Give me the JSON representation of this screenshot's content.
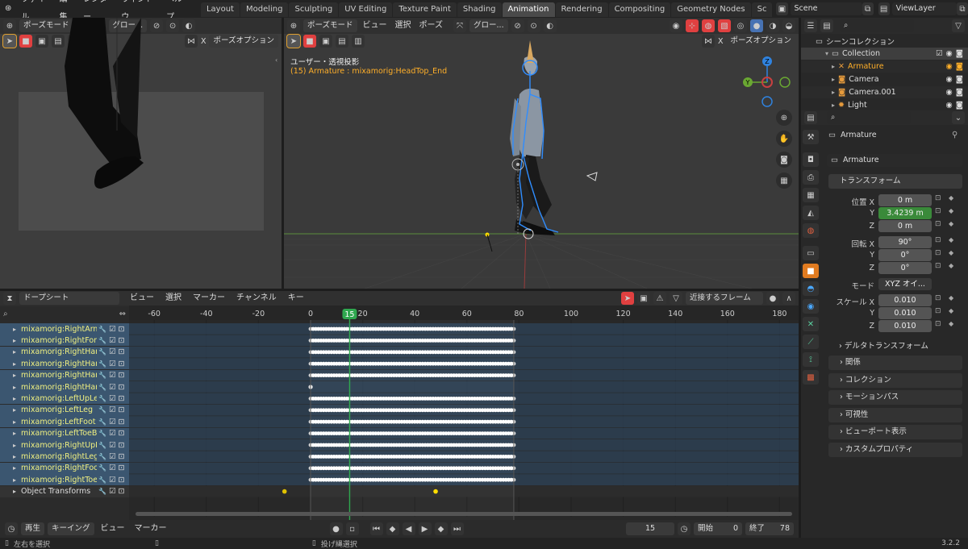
{
  "topbar": {
    "menus": [
      "ファイル",
      "編集",
      "レンダー",
      "ウィンドウ",
      "ヘルプ"
    ],
    "workspaces": [
      "Layout",
      "Modeling",
      "Sculpting",
      "UV Editing",
      "Texture Paint",
      "Shading",
      "Animation",
      "Rendering",
      "Compositing",
      "Geometry Nodes",
      "Sc"
    ],
    "active_workspace": "Animation",
    "scene": "Scene",
    "view_layer": "ViewLayer"
  },
  "left_viewport": {
    "mode": "ポーズモード",
    "transform": "グロー...",
    "x_label": "X",
    "options": "ポーズオプション"
  },
  "main_viewport": {
    "mode": "ポーズモード",
    "menus": [
      "ビュー",
      "選択",
      "ポーズ"
    ],
    "transform": "グロー...",
    "x_label": "X",
    "options": "ポーズオプション",
    "projection": "ユーザー・透視投影",
    "active": "(15) Armature : mixamorig:HeadTop_End",
    "gizmo": {
      "x": "X",
      "y": "Y",
      "z": "Z"
    }
  },
  "outliner": {
    "root": "シーンコレクション",
    "items": [
      {
        "label": "Collection",
        "highlight": false
      },
      {
        "label": "Armature",
        "highlight": true
      },
      {
        "label": "Camera",
        "highlight": false
      },
      {
        "label": "Camera.001",
        "highlight": false
      },
      {
        "label": "Light",
        "highlight": false
      }
    ]
  },
  "properties": {
    "object_name": "Armature",
    "data_name": "Armature",
    "transform_title": "トランスフォーム",
    "location_label": "位置 X",
    "y_label": "Y",
    "z_label": "Z",
    "loc_x": "0 m",
    "loc_y": "3.4239 m",
    "loc_z": "0 m",
    "rotation_label": "回転 X",
    "rot_x": "90°",
    "rot_y": "0°",
    "rot_z": "0°",
    "mode_label": "モード",
    "mode_value": "XYZ オイ...",
    "scale_label": "スケール X",
    "scale_x": "0.010",
    "scale_y": "0.010",
    "scale_z": "0.010",
    "delta": "デルタトランスフォーム",
    "panels": [
      "関係",
      "コレクション",
      "モーションパス",
      "可視性",
      "ビューポート表示",
      "カスタムプロパティ"
    ]
  },
  "dopesheet": {
    "mode": "ドープシート",
    "menus": [
      "ビュー",
      "選択",
      "マーカー",
      "チャンネル",
      "キー"
    ],
    "snap": "近接するフレーム",
    "ruler": [
      "-60",
      "-40",
      "-20",
      "0",
      "20",
      "40",
      "60",
      "80",
      "100",
      "120",
      "140",
      "160",
      "180"
    ],
    "current_frame": "15",
    "channels": [
      {
        "label": "mixamorig:RightArm",
        "dense": true
      },
      {
        "label": "mixamorig:RightForeA",
        "dense": true
      },
      {
        "label": "mixamorig:RightHand",
        "dense": true
      },
      {
        "label": "mixamorig:RightHand",
        "dense": true
      },
      {
        "label": "mixamorig:RightHand",
        "dense": true
      },
      {
        "label": "mixamorig:RightHand",
        "dense": false
      },
      {
        "label": "mixamorig:LeftUpLeg",
        "dense": true
      },
      {
        "label": "mixamorig:LeftLeg",
        "dense": true
      },
      {
        "label": "mixamorig:LeftFoot",
        "dense": true
      },
      {
        "label": "mixamorig:LeftToeBa",
        "dense": true
      },
      {
        "label": "mixamorig:RightUpLe",
        "dense": true
      },
      {
        "label": "mixamorig:RightLeg",
        "dense": true
      },
      {
        "label": "mixamorig:RightFoot",
        "dense": true
      },
      {
        "label": "mixamorig:RightToeB",
        "dense": true
      },
      {
        "label": "Object Transforms",
        "dense": false
      }
    ]
  },
  "timeline": {
    "playback": "再生",
    "keying": "キーイング",
    "view": "ビュー",
    "marker": "マーカー",
    "frame": "15",
    "start_label": "開始",
    "start": "0",
    "end_label": "終了",
    "end": "78"
  },
  "status": {
    "left": "左右を選択",
    "middle": "投げ縄選択",
    "version": "3.2.2"
  },
  "colors": {
    "accent": "#4772b3",
    "keyframe": "#ffffff",
    "playhead": "#2fa84f",
    "selected_text": "#ffaf29"
  }
}
